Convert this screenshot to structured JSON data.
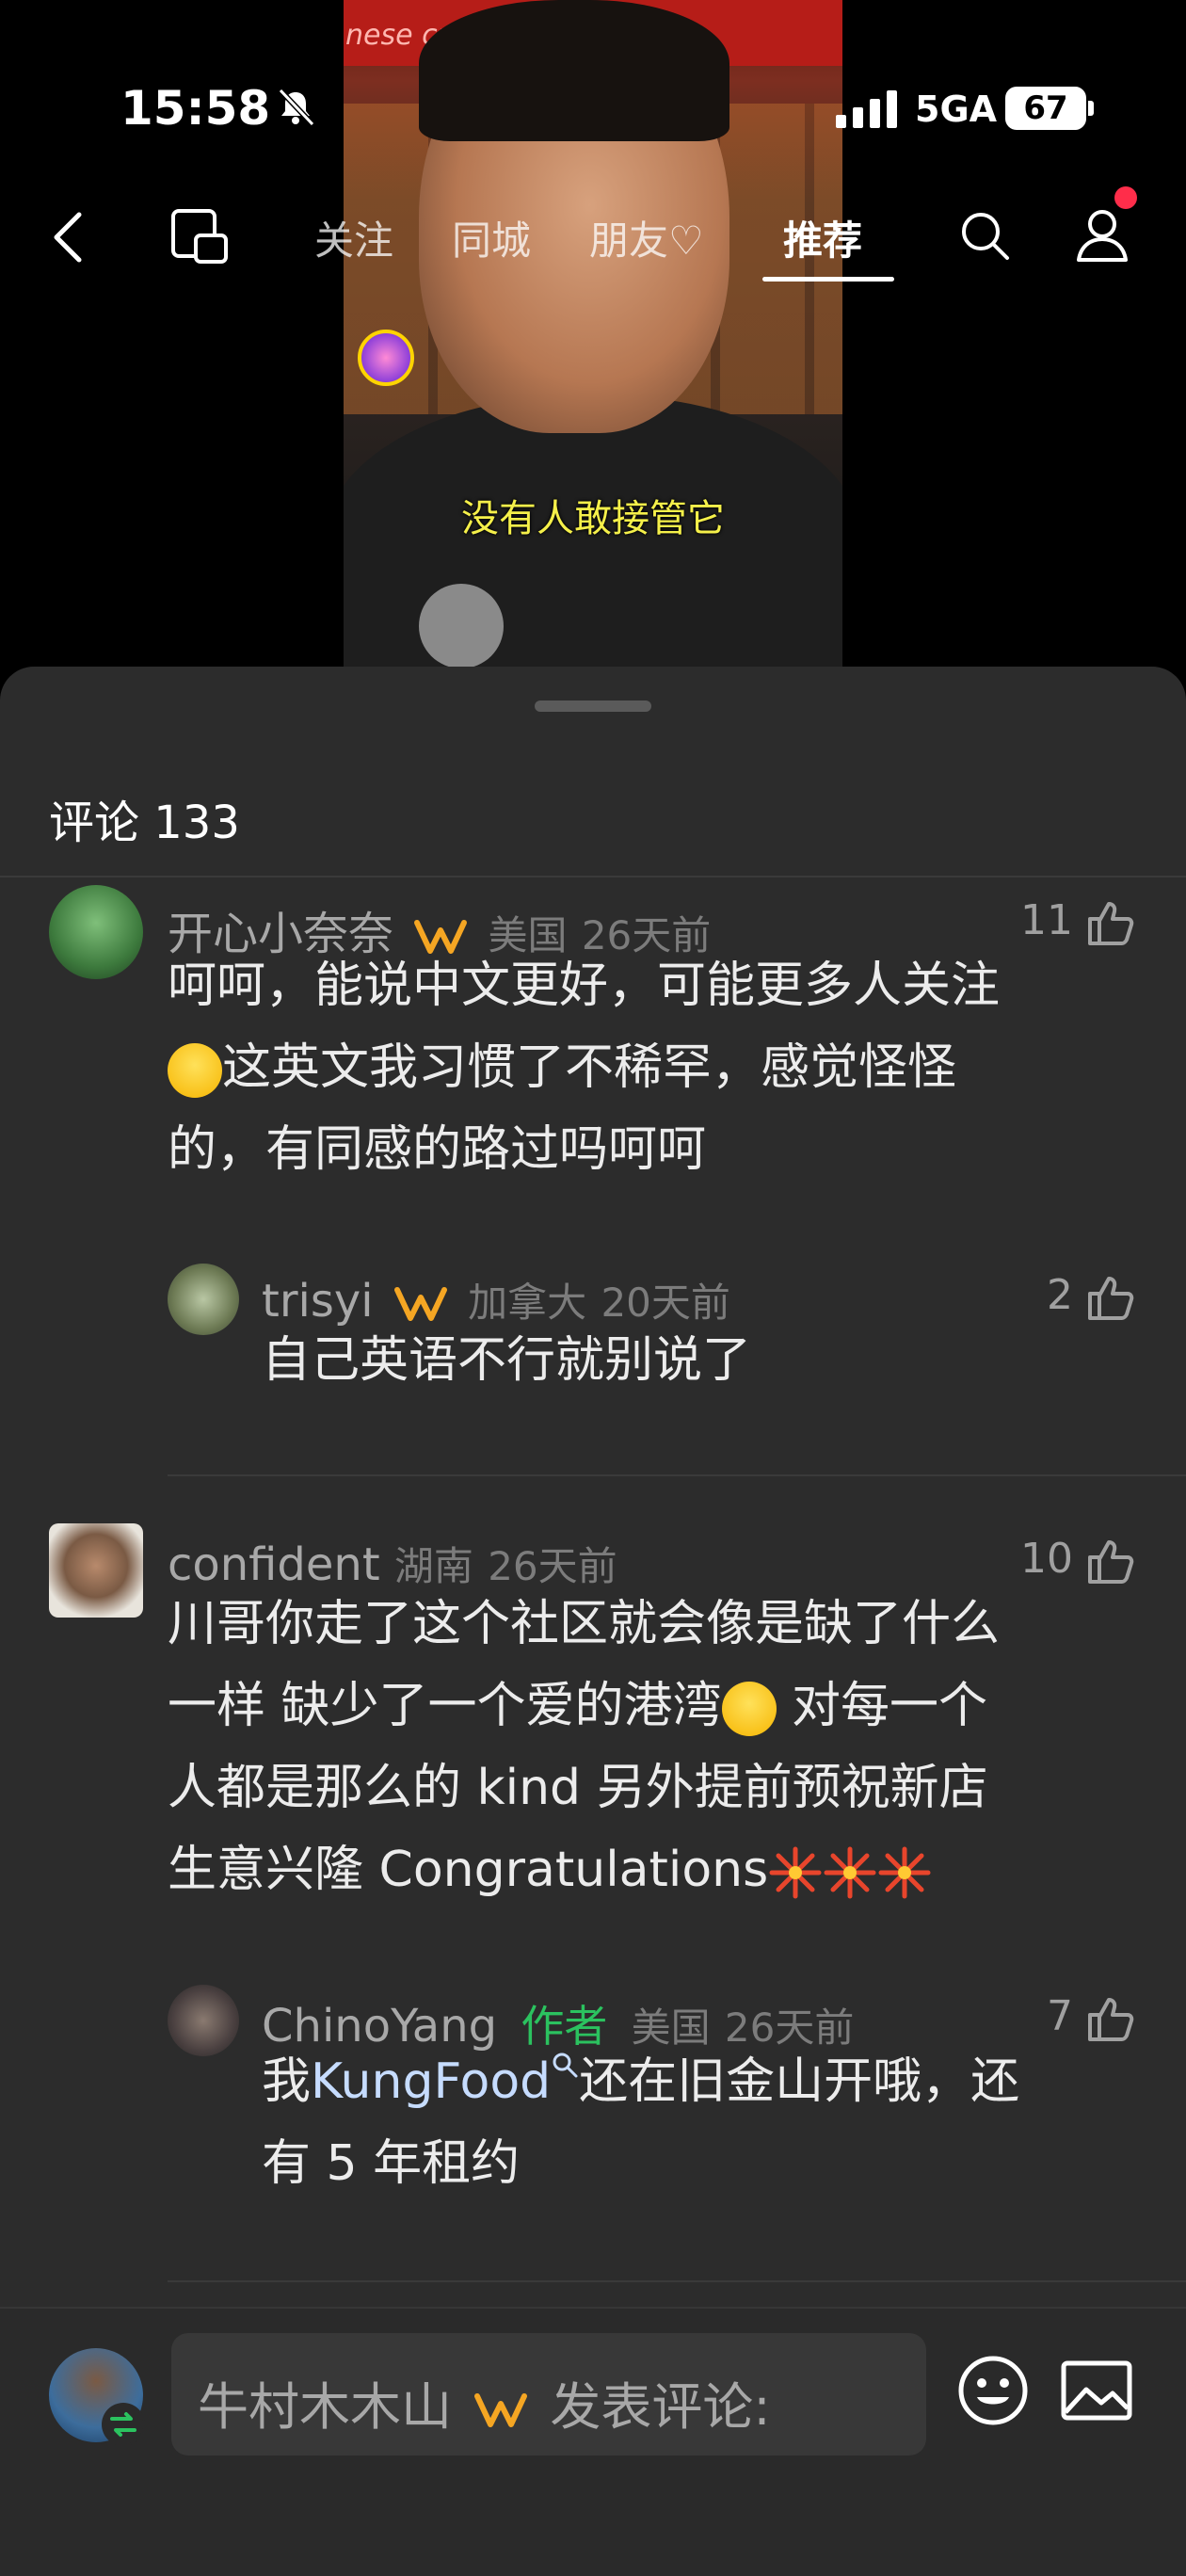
{
  "status_bar": {
    "time": "15:58",
    "network": "5GA",
    "battery": "67"
  },
  "nav": {
    "tabs": [
      {
        "label": "关注"
      },
      {
        "label": "同城"
      },
      {
        "label": "朋友♡"
      },
      {
        "label": "推荐"
      }
    ],
    "active_tab": "推荐"
  },
  "video": {
    "sign_text": "nese cuisine",
    "subtitle": "没有人敢接管它"
  },
  "comments_header": {
    "label": "评论 133"
  },
  "comments": [
    {
      "username": "开心小奈奈",
      "location": "美国",
      "time": "26天前",
      "likes": "11",
      "lines": [
        "呵呵，能说中文更好，可能更多人关注",
        "这英文我习惯了不稀罕，感觉怪怪",
        "的，有同感的路过吗呵呵"
      ],
      "reply": {
        "username": "trisyi",
        "location": "加拿大",
        "time": "20天前",
        "likes": "2",
        "text": "自己英语不行就别说了"
      }
    },
    {
      "username": "confident",
      "location": "湖南",
      "time": "26天前",
      "likes": "10",
      "lines": [
        "川哥你走了这个社区就会像是缺了什么",
        "一样 缺少了一个爱的港湾",
        " 对每一个",
        "人都是那么的 kind  另外提前预祝新店",
        "生意兴隆 Congratulations"
      ],
      "reply": {
        "username": "ChinoYang",
        "author_tag": "作者",
        "location": "美国",
        "time": "26天前",
        "likes": "7",
        "text_prefix": "我",
        "link": "KungFood",
        "text_suffix": "还在旧金山开哦，还",
        "text_line2": "有 5 年租约"
      }
    }
  ],
  "footer": {
    "input_name": "牛村木木山",
    "input_prompt": "发表评论:"
  },
  "colors": {
    "sheet_bg": "#2c2c2c",
    "author_green": "#2bc25f",
    "link_blue": "#c6dcff",
    "badge_orange": "#f5a623"
  }
}
